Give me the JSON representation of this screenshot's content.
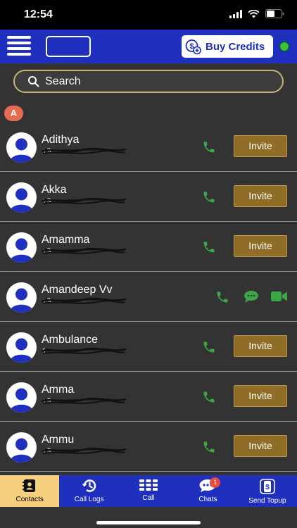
{
  "status_bar": {
    "time": "12:54"
  },
  "header": {
    "buy_credits_label": "Buy Credits",
    "online_status_color": "#38c23a",
    "brand_color": "#1f2fbe"
  },
  "search": {
    "placeholder": "Search"
  },
  "section": {
    "letter": "A"
  },
  "contacts": [
    {
      "name": "Adithya",
      "phone_partial": "+9",
      "invite_label": "Invite",
      "is_app_user": false
    },
    {
      "name": "Akka",
      "phone_partial": "+9",
      "invite_label": "Invite",
      "is_app_user": false
    },
    {
      "name": "Amamma",
      "phone_partial": "+9",
      "invite_label": "Invite",
      "is_app_user": false
    },
    {
      "name": "Amandeep Vv",
      "phone_partial": "+9",
      "invite_label": "",
      "is_app_user": true
    },
    {
      "name": "Ambulance",
      "phone_partial": "1",
      "invite_label": "Invite",
      "is_app_user": false
    },
    {
      "name": "Amma",
      "phone_partial": "+9",
      "invite_label": "Invite",
      "is_app_user": false
    },
    {
      "name": "Ammu",
      "phone_partial": "+9",
      "invite_label": "Invite",
      "is_app_user": false
    }
  ],
  "tabbar": {
    "contacts_label": "Contacts",
    "call_logs_label": "Call Logs",
    "call_label": "Call",
    "chats_label": "Chats",
    "chats_badge": "1",
    "send_topup_label": "Send Topup",
    "active_color": "#f6cf7d"
  },
  "icons": {
    "phone": "phone-icon",
    "chat": "chat-bubble-icon",
    "video": "video-camera-icon",
    "search": "search-icon",
    "menu": "hamburger-menu-icon",
    "credits": "dollar-add-icon"
  }
}
